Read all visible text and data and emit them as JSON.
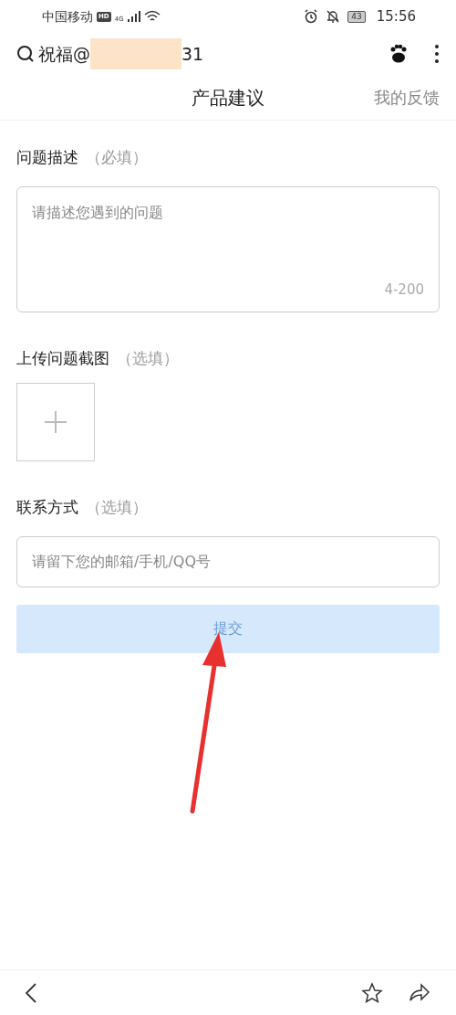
{
  "status_bar": {
    "carrier": "中国移动",
    "hd": "HD",
    "network": "4G",
    "battery": "43",
    "time": "15:56"
  },
  "search_bar": {
    "prefix": "祝福@",
    "suffix": "31",
    "redacted": true
  },
  "tabs": [
    {
      "label": "产品建议",
      "selected": true
    },
    {
      "label": "我的反馈",
      "selected": false
    }
  ],
  "form": {
    "description": {
      "label": "问题描述",
      "note": "（必填）",
      "placeholder": "请描述您遇到的问题",
      "counter": "4-200"
    },
    "screenshot": {
      "label": "上传问题截图",
      "note": "（选填）"
    },
    "contact": {
      "label": "联系方式",
      "note": "（选填）",
      "placeholder": "请留下您的邮箱/手机/QQ号"
    },
    "submit": {
      "label": "提交",
      "disabled": true
    }
  },
  "annotation": {
    "kind": "arrow",
    "color": "#e8302e"
  }
}
